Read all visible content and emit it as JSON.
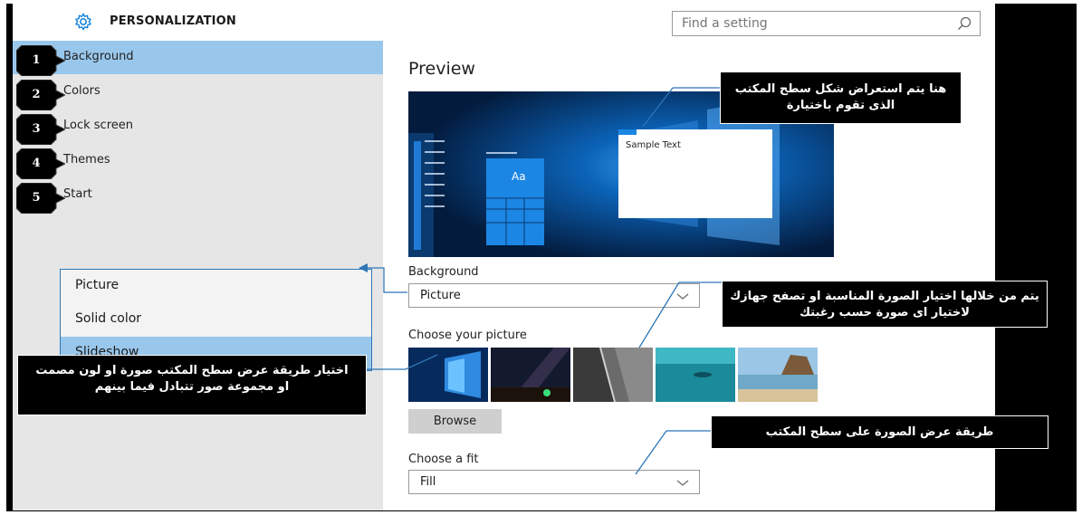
{
  "header": {
    "title": "PERSONALIZATION",
    "search_placeholder": "Find a setting"
  },
  "sidebar": {
    "items": [
      {
        "label": "Background",
        "number": "1"
      },
      {
        "label": "Colors",
        "number": "2"
      },
      {
        "label": "Lock screen",
        "number": "3"
      },
      {
        "label": "Themes",
        "number": "4"
      },
      {
        "label": "Start",
        "number": "5"
      }
    ],
    "selected": "Background"
  },
  "dropdown": {
    "options": [
      "Picture",
      "Solid color",
      "Slideshow"
    ],
    "highlighted": "Slideshow"
  },
  "main": {
    "preview_heading": "Preview",
    "preview_sample_text": "Sample Text",
    "preview_tile_text": "Aa",
    "background_label": "Background",
    "background_value": "Picture",
    "choose_picture_label": "Choose your picture",
    "browse_label": "Browse",
    "choose_fit_label": "Choose a fit",
    "fit_value": "Fill"
  },
  "annotations": {
    "preview_note": "هنا يتم استعراض شكل سطح المكتب الذى تقوم باختيارة",
    "picture_note": "يتم من خلالها اختيار الصورة المناسبة او تصفح جهازك لاختيار اى صورة حسب رغبتك",
    "method_note": "اختيار طريقة عرض سطح المكتب صورة او لون مصمت او مجموعة صور تتبادل فيما بينهم",
    "fit_note": "طريقة عرض الصورة على سطح المكتب"
  },
  "colors": {
    "accent": "#0078d7",
    "selection": "#99c7ec",
    "sidebar_bg": "#e6e6e6",
    "annotation_bg": "#000000"
  }
}
